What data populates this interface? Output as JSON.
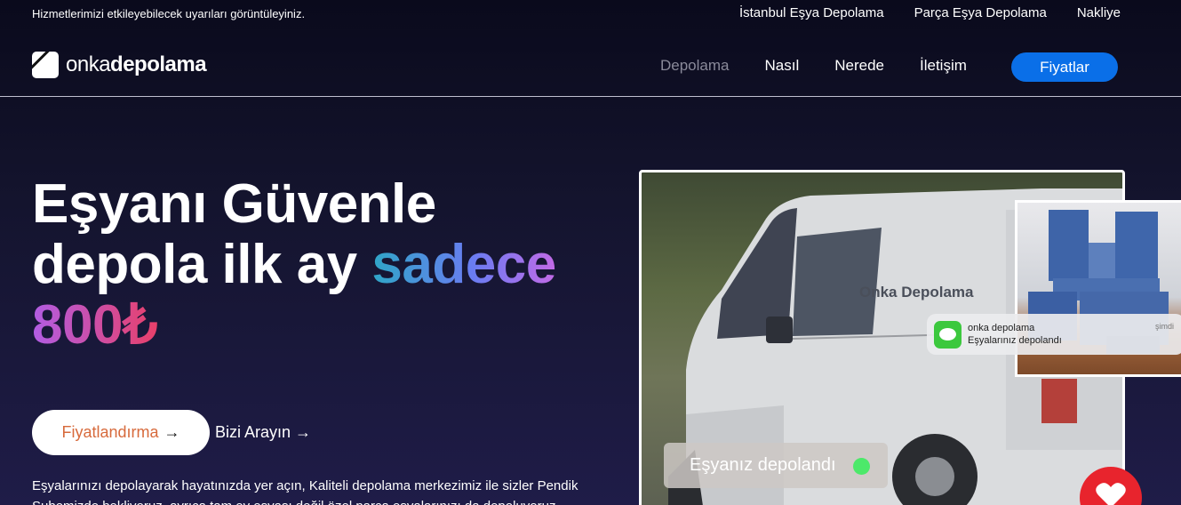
{
  "topbar": {
    "notice": "Hizmetlerimizi etkileyebilecek uyarıları görüntüleyiniz.",
    "links": [
      "İstanbul Eşya Depolama",
      "Parça Eşya Depolama",
      "Nakliye"
    ]
  },
  "header": {
    "logo_light": "onka",
    "logo_bold": "depolama",
    "nav": [
      "Depolama",
      "Nasıl",
      "Nerede",
      "İletişim"
    ],
    "cta": "Fiyatlar"
  },
  "hero": {
    "line1": "Eşyanı Güvenle",
    "line2_plain": "depola ilk ay ",
    "line2_accent": "sadece",
    "line3_accent": "800₺",
    "primary_button": "Fiyatlandırma",
    "primary_arrow": "→",
    "secondary_button": "Bizi Arayın →",
    "description": "Eşyalarınızı depolayarak hayatınızda yer açın, Kaliteli depolama merkezimiz ile sizler Pendik Şubemizde bekliyoruz, ayrıca tam ev eşyası değil özel parça eşyalarınızı da depoluyoruz."
  },
  "photo": {
    "van_brand": "Onka Depolama",
    "toast": "Eşyanız depolandı"
  },
  "notification": {
    "sender": "onka depolama",
    "message": "Eşyalarınız depolandı",
    "time": "şimdi"
  },
  "icons": {
    "message_app": "message-app-icon",
    "heart": "heart-icon",
    "logo": "logo-mark-icon"
  },
  "colors": {
    "accent_blue": "#0a6fe8",
    "heart_red": "#e8242d",
    "status_green": "#4ce96a"
  }
}
